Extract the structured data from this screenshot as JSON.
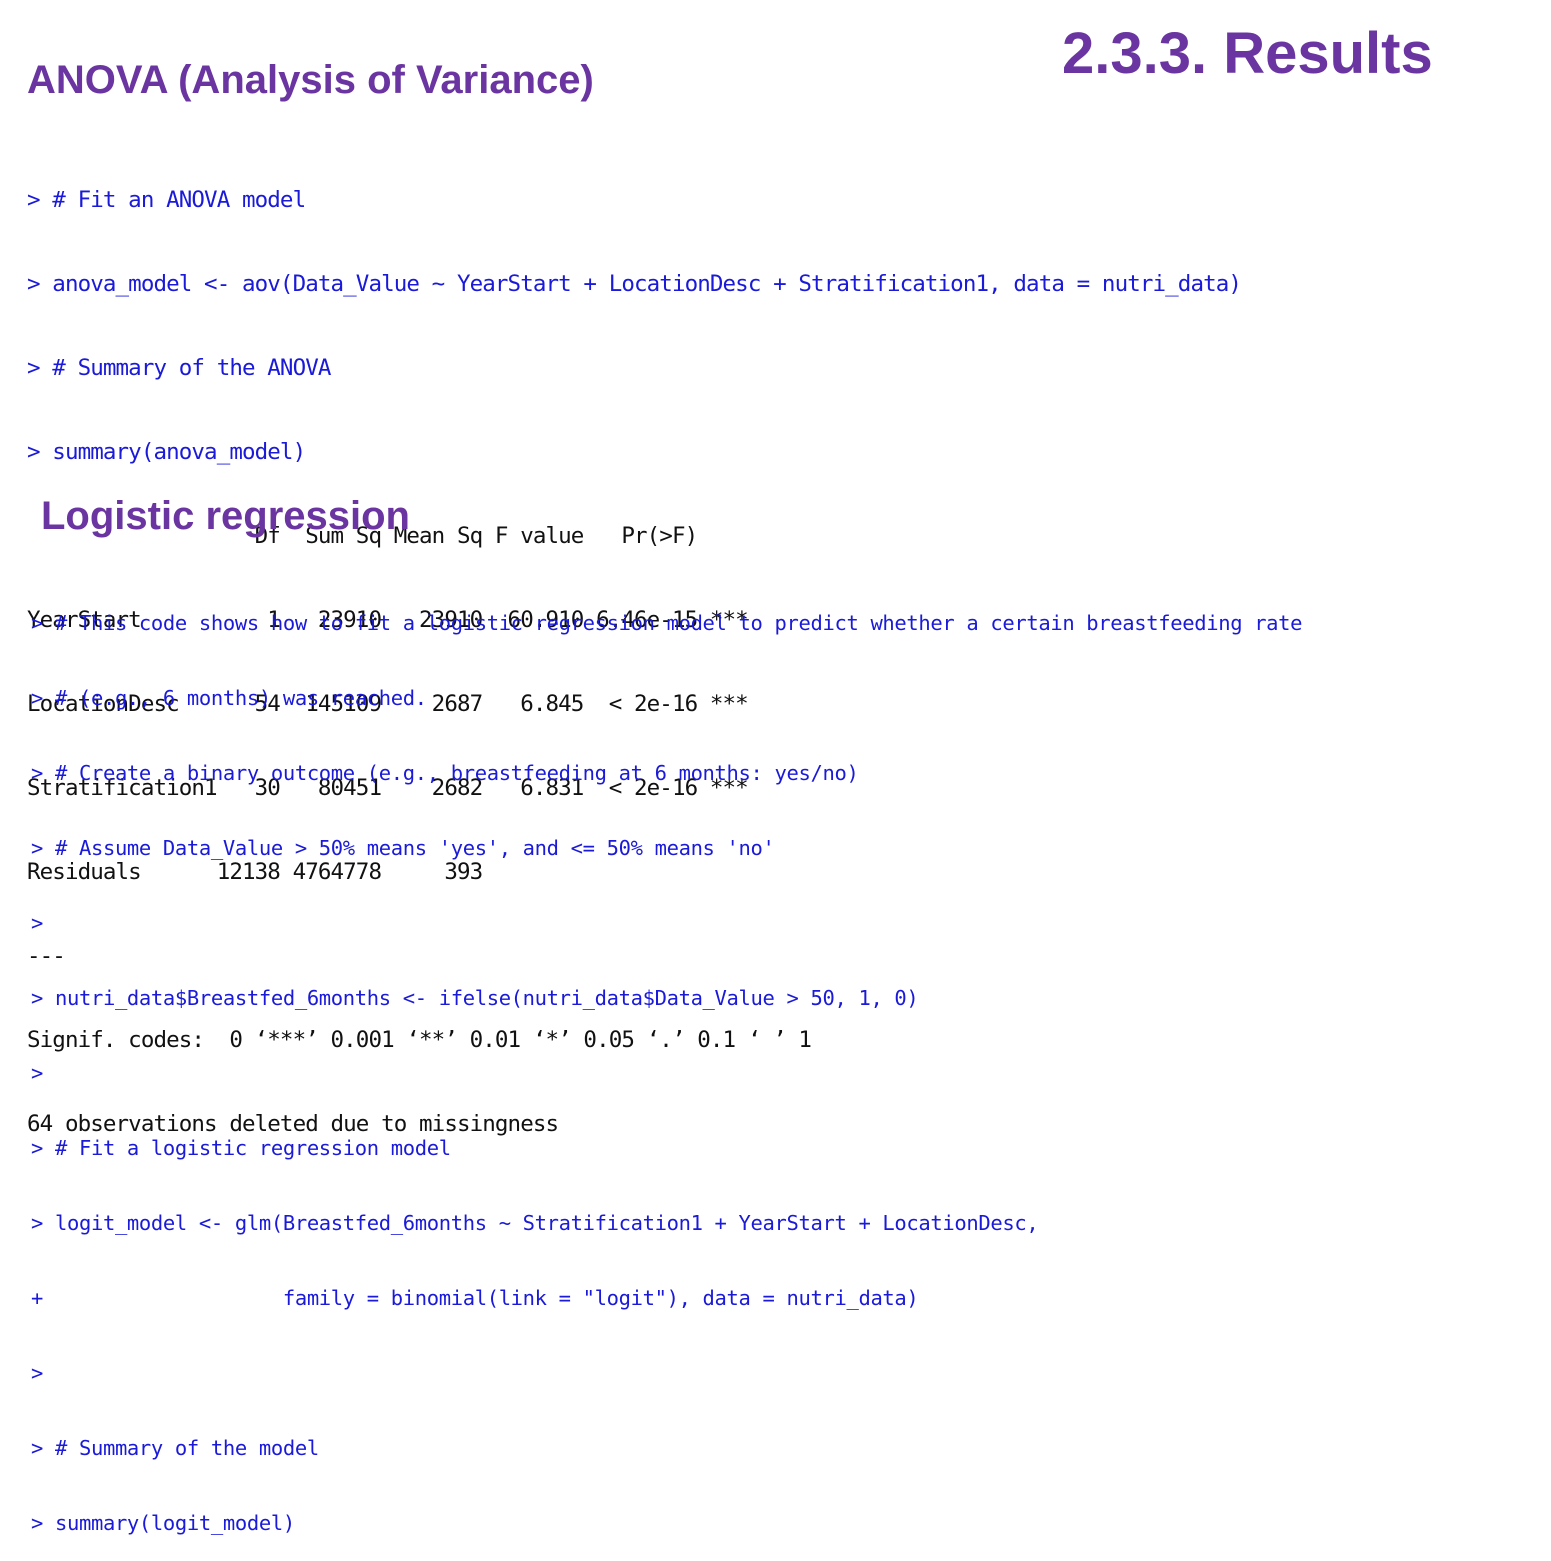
{
  "slide_title": "2.3.3. Results",
  "anova_section": {
    "heading": "ANOVA (Analysis of Variance)",
    "console_lines": [
      {
        "type": "cmd",
        "text": "> # Fit an ANOVA model"
      },
      {
        "type": "cmd",
        "text": "> anova_model <- aov(Data_Value ~ YearStart + LocationDesc + Stratification1, data = nutri_data)"
      },
      {
        "type": "cmd",
        "text": "> # Summary of the ANOVA"
      },
      {
        "type": "cmd",
        "text": "> summary(anova_model)"
      },
      {
        "type": "out",
        "text": "                  Df  Sum Sq Mean Sq F value   Pr(>F)    "
      },
      {
        "type": "out",
        "text": "YearStart          1   23910   23910  60.910 6.46e-15 ***"
      },
      {
        "type": "out",
        "text": "LocationDesc      54  145109    2687   6.845  < 2e-16 ***"
      },
      {
        "type": "out",
        "text": "Stratification1   30   80451    2682   6.831  < 2e-16 ***"
      },
      {
        "type": "out",
        "text": "Residuals      12138 4764778     393                     "
      },
      {
        "type": "out",
        "text": "---"
      },
      {
        "type": "out",
        "text": "Signif. codes:  0 ‘***’ 0.001 ‘**’ 0.01 ‘*’ 0.05 ‘.’ 0.1 ‘ ’ 1"
      },
      {
        "type": "out",
        "text": "64 observations deleted due to missingness"
      }
    ]
  },
  "logistic_section": {
    "heading": "Logistic regression",
    "console_lines": [
      {
        "type": "cmd",
        "text": "> # This code shows how to fit a logistic regression model to predict whether a certain breastfeeding rate"
      },
      {
        "type": "cmd",
        "text": "> # (e.g., 6 months) was reached."
      },
      {
        "type": "cmd",
        "text": "> # Create a binary outcome (e.g., breastfeeding at 6 months: yes/no)"
      },
      {
        "type": "cmd",
        "text": "> # Assume Data_Value > 50% means 'yes', and <= 50% means 'no'"
      },
      {
        "type": "cmd",
        "text": "> "
      },
      {
        "type": "cmd",
        "text": "> nutri_data$Breastfed_6months <- ifelse(nutri_data$Data_Value > 50, 1, 0)"
      },
      {
        "type": "cmd",
        "text": "> "
      },
      {
        "type": "cmd",
        "text": "> # Fit a logistic regression model"
      },
      {
        "type": "cmd",
        "text": "> logit_model <- glm(Breastfed_6months ~ Stratification1 + YearStart + LocationDesc,"
      },
      {
        "type": "cmd",
        "text": "+                    family = binomial(link = \"logit\"), data = nutri_data)"
      },
      {
        "type": "cmd",
        "text": "> "
      },
      {
        "type": "cmd",
        "text": "> # Summary of the model"
      },
      {
        "type": "cmd",
        "text": "> summary(logit_model)"
      }
    ]
  },
  "colors": {
    "heading": "#6a35a0",
    "command": "#1a1ad8",
    "output": "#111111"
  }
}
